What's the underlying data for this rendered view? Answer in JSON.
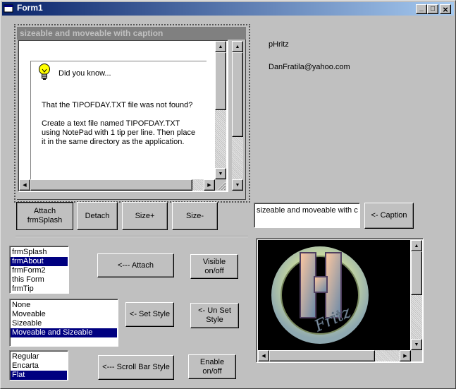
{
  "window": {
    "title": "Form1",
    "minimize_glyph": "_",
    "maximize_glyph": "□",
    "close_glyph": "×"
  },
  "embedded_form": {
    "caption": "sizeable and moveable with caption"
  },
  "tip": {
    "heading": "Did you know...",
    "line1": "That the TIPOFDAY.TXT file was not found?",
    "line2": "Create a text file named TIPOFDAY.TXT",
    "line3": "using NotePad with 1 tip per line. Then place",
    "line4": "it in the same directory as the application."
  },
  "info": {
    "name": "pHritz",
    "email": "DanFratila@yahoo.com"
  },
  "buttons": {
    "attach_splash": "Attach\nfrmSplash",
    "detach": "Detach",
    "size_plus": "Size+",
    "size_minus": "Size-",
    "caption": "<- Caption",
    "attach": "<--- Attach",
    "visible": "Visible\non/off",
    "set_style": "<- Set Style",
    "unset_style": "<- Un Set\nStyle",
    "scroll_bar_style": "<--- Scroll Bar Style",
    "enable": "Enable\non/off"
  },
  "caption_input": {
    "value": "sizeable and moveable with c"
  },
  "forms_list": {
    "items": [
      "frmSplash",
      "frmAbout",
      "frmForm2",
      "this Form",
      "frmTip"
    ],
    "selected_index": 1
  },
  "style_list": {
    "items": [
      "None",
      "Moveable",
      "Sizeable",
      "Moveable and Sizeable"
    ],
    "selected_index": 3
  },
  "scrollbar_style_list": {
    "items": [
      "Regular",
      "Encarta",
      "Flat"
    ],
    "selected_index": 2
  },
  "logo": {
    "text": "Fritz"
  },
  "colors": {
    "title_start": "#0a246a",
    "title_end": "#a6caf0",
    "selection": "#000080",
    "face": "#c0c0c0"
  }
}
